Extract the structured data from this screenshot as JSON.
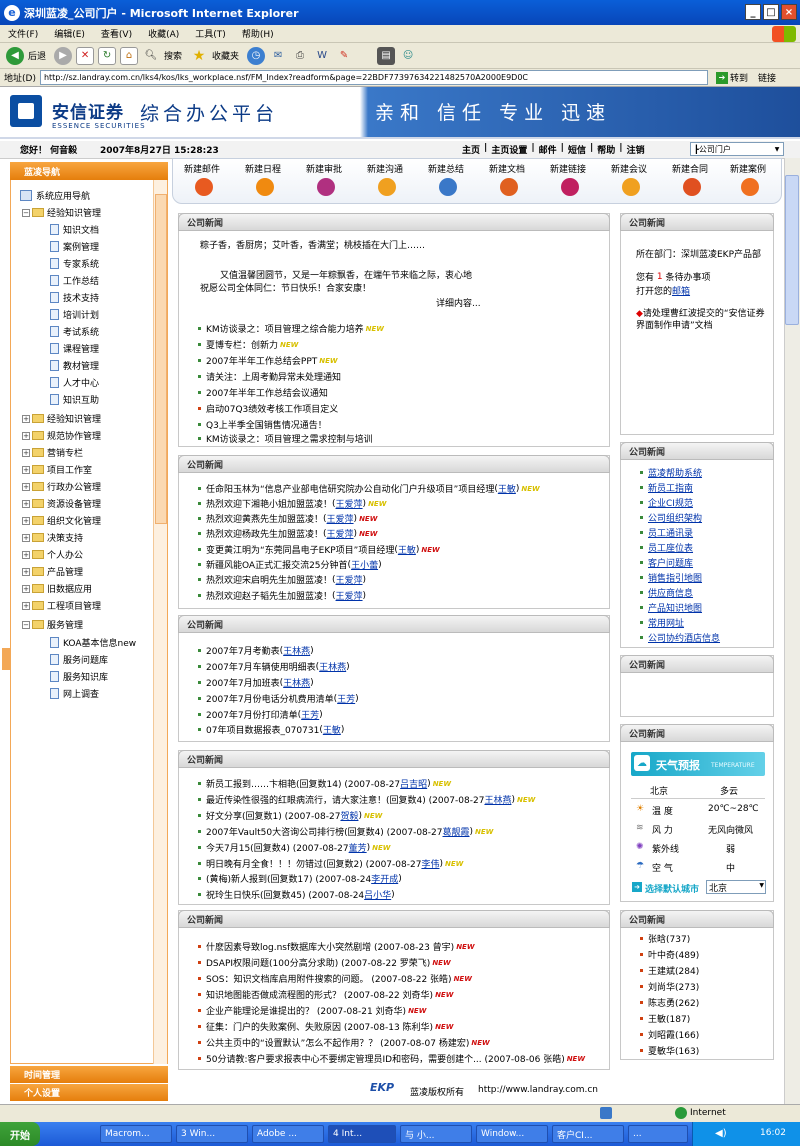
{
  "window": {
    "title": "深圳蓝凌_公司门户 - Microsoft Internet Explorer",
    "min": "_",
    "max": "□",
    "close": "×"
  },
  "menu": [
    "文件(F)",
    "编辑(E)",
    "查看(V)",
    "收藏(A)",
    "工具(T)",
    "帮助(H)"
  ],
  "toolbar": {
    "back": "后退",
    "search": "搜索",
    "favorites": "收藏夹"
  },
  "address": {
    "label": "地址(D)",
    "url": "http://sz.landray.com.cn/lks4/kos/lks_workplace.nsf/FM_Index?readform&page=22BDF77397634221482570A2000E9D0C",
    "go": "转到",
    "links": "链接"
  },
  "banner": {
    "logo_cn": "安信证券",
    "logo_en": "ESSENCE SECURITIES",
    "slogan": "综合办公平台",
    "motto": "亲和 信任 专业 迅速"
  },
  "header": {
    "greeting": "您好！ 何音毅",
    "datetime": "2007年8月27日 15:28:23",
    "links": [
      "主页",
      "主页设置",
      "邮件",
      "短信",
      "帮助",
      "注销"
    ],
    "portal": "┣公司门户"
  },
  "sidebar": {
    "title": "蓝凌导航",
    "root": "系统应用导航",
    "items": [
      "经验知识管理",
      "知识文档",
      "案例管理",
      "专家系统",
      "工作总结",
      "技术支持",
      "培训计划",
      "考试系统",
      "课程管理",
      "教材管理",
      "人才中心",
      "知识互助",
      "经验知识管理",
      "规范协作管理",
      "营销专栏",
      "项目工作室",
      "行政办公管理",
      "资源设备管理",
      "组织文化管理",
      "决策支持",
      "个人办公",
      "产品管理",
      "旧数据应用",
      "工程项目管理",
      "服务管理",
      "KOA基本信息new",
      "服务问题库",
      "服务知识库",
      "网上调查"
    ],
    "time_mgmt": "时间管理",
    "personal": "个人设置"
  },
  "iconbar": [
    "新建邮件",
    "新建日程",
    "新建审批",
    "新建沟通",
    "新建总结",
    "新建文档",
    "新建链接",
    "新建会议",
    "新建合同",
    "新建案例"
  ],
  "news1": {
    "title": "公司新闻",
    "poem": "粽子香，香厨房；艾叶香，香满堂；桃枝插在大门上……",
    "body1": "又值温馨团圆节，又是一年粽飘香，在端午节来临之际，衷心地",
    "body2": "祝愿公司全体同仁：节日快乐！合家安康！",
    "more": "详细内容...",
    "items": [
      "KM访谈录之：项目管理之综合能力培养",
      "夏博专栏：创新力",
      "2007年半年工作总结会PPT",
      "请关注：上周考勤异常未处理通知",
      "2007年半年工作总结会议通知",
      "启动07Q3绩效考核工作项目定义",
      "Q3上半季全国销售情况通告！",
      "KM访谈录之：项目管理之需求控制与培训"
    ]
  },
  "news2": {
    "title": "公司新闻",
    "items": [
      "任命阳玉林为“信息产业部电信研究院办公自动化门户升级项目”项目经理",
      "热烈欢迎下湘艳小姐加盟蓝凌！",
      "热烈欢迎黄燕先生加盟蓝凌！",
      "热烈欢迎杨政先生加盟蓝凌！",
      "变更黄江明为“东莞同昌电子EKP项目”项目经理",
      "新疆风能OA正式汇报交流25分钟首",
      "热烈欢迎宋启明先生加盟蓝凌！",
      "热烈欢迎赵子韬先生加盟蓝凌！"
    ],
    "authors": [
      "王敏",
      "王爱萍",
      "王爱萍",
      "王爱萍",
      "王敏",
      "王小蕾",
      "王爱萍",
      "王爱萍"
    ]
  },
  "news3": {
    "title": "公司新闻",
    "items": [
      "2007年7月考勤表",
      "2007年7月车辆使用明细表",
      "2007年7月加班表",
      "2007年7月份电话分机费用清单",
      "2007年7月份打印清单",
      "07年项目数据报表_070731"
    ],
    "authors": [
      "王林燕",
      "王林燕",
      "王林燕",
      "王芳",
      "王芳",
      "王敏"
    ]
  },
  "news4": {
    "title": "公司新闻",
    "items": [
      "新员工报到……卞相艳(回复数14) (2007-08-27",
      "最近传染性很强的红眼病流行，请大家注意！(回复数4) (2007-08-27",
      "好文分享(回复数1) (2007-08-27",
      "2007年Vault50大咨询公司排行榜(回复数4) (2007-08-27",
      "今天7月15(回复数4) (2007-08-27",
      "明日晚有月全食！！！勿错过(回复数2) (2007-08-27",
      "(黄梅)新人报到(回复数17) (2007-08-24",
      "祝玲生日快乐(回复数45) (2007-08-24"
    ],
    "authors": [
      "吕吉昭",
      "王林燕",
      "贺毅",
      "葛靓霞",
      "董芳",
      "李伟",
      "李开成",
      "吕小华"
    ]
  },
  "news5": {
    "title": "公司新闻",
    "items": [
      "什麽因素导致log.nsf数据库大小突然剧增 (2007-08-23 曾宇)",
      "DSAPI权限问题(100分高分求助) (2007-08-22 罗荣飞)",
      "SOS：知识文档库启用附件搜索的问题。 (2007-08-22 张皓)",
      "知识地图能否做成流程图的形式？ (2007-08-22 刘奇华)",
      "企业产能理论是谁提出的？ (2007-08-21 刘奇华)",
      "征集：门户的失败案例、失败原因 (2007-08-13 陈利华)",
      "公共主页中的“设置默认”怎么不起作用？？ (2007-08-07 杨建宏)",
      "50分请教:客户要求报表中心不要绑定管理员ID和密码，需要创建个... (2007-08-06 张皓)"
    ]
  },
  "side1": {
    "title": "公司新闻",
    "dept": "所在部门：深圳蓝凌EKP产品部",
    "todo_pre": "您有",
    "todo_num": "1",
    "todo_post": "条待办事项",
    "todo_open": "打开您的",
    "todo_link": "邮箱",
    "approve": "请处理曹红波提交的“安信证券界面制作申请”文档"
  },
  "side2": {
    "title": "公司新闻",
    "items": [
      "蓝凌帮助系统",
      "新员工指南",
      "企业CI规范",
      "公司组织架构",
      "员工通讯录",
      "员工座位表",
      "客户问题库",
      "销售指引地图",
      "供应商信息",
      "产品知识地图",
      "常用网址",
      "公司协约酒店信息"
    ]
  },
  "side3": {
    "title": "公司新闻"
  },
  "weather": {
    "title": "公司新闻",
    "banner": "天气预报",
    "banner_en": "TEMPERATURE",
    "city": "北京",
    "cond": "多云",
    "rows": [
      [
        "温  度",
        "20℃~28℃"
      ],
      [
        "风  力",
        "无风向微风"
      ],
      [
        "紫外线",
        "弱"
      ],
      [
        "空  气",
        "中"
      ]
    ],
    "select_label": "选择默认城市",
    "select_val": "北京"
  },
  "side5": {
    "title": "公司新闻",
    "items": [
      "张晗(737)",
      "叶中奇(489)",
      "王建斌(284)",
      "刘尚华(273)",
      "陈志勇(262)",
      "王敏(187)",
      "刘昭霞(166)",
      "夏敏华(163)"
    ]
  },
  "footer": {
    "logo": "EKP",
    "copy": "蓝凌版权所有",
    "url": "http://www.landray.com.cn"
  },
  "status": {
    "zone": "Internet"
  },
  "taskbar": {
    "start": "开始",
    "buttons": [
      "Macrom...",
      "3 Win...",
      "Adobe ...",
      "4 Int...",
      "与 小...",
      "Window...",
      "客户CI...",
      "..."
    ],
    "clock": "16:02"
  }
}
